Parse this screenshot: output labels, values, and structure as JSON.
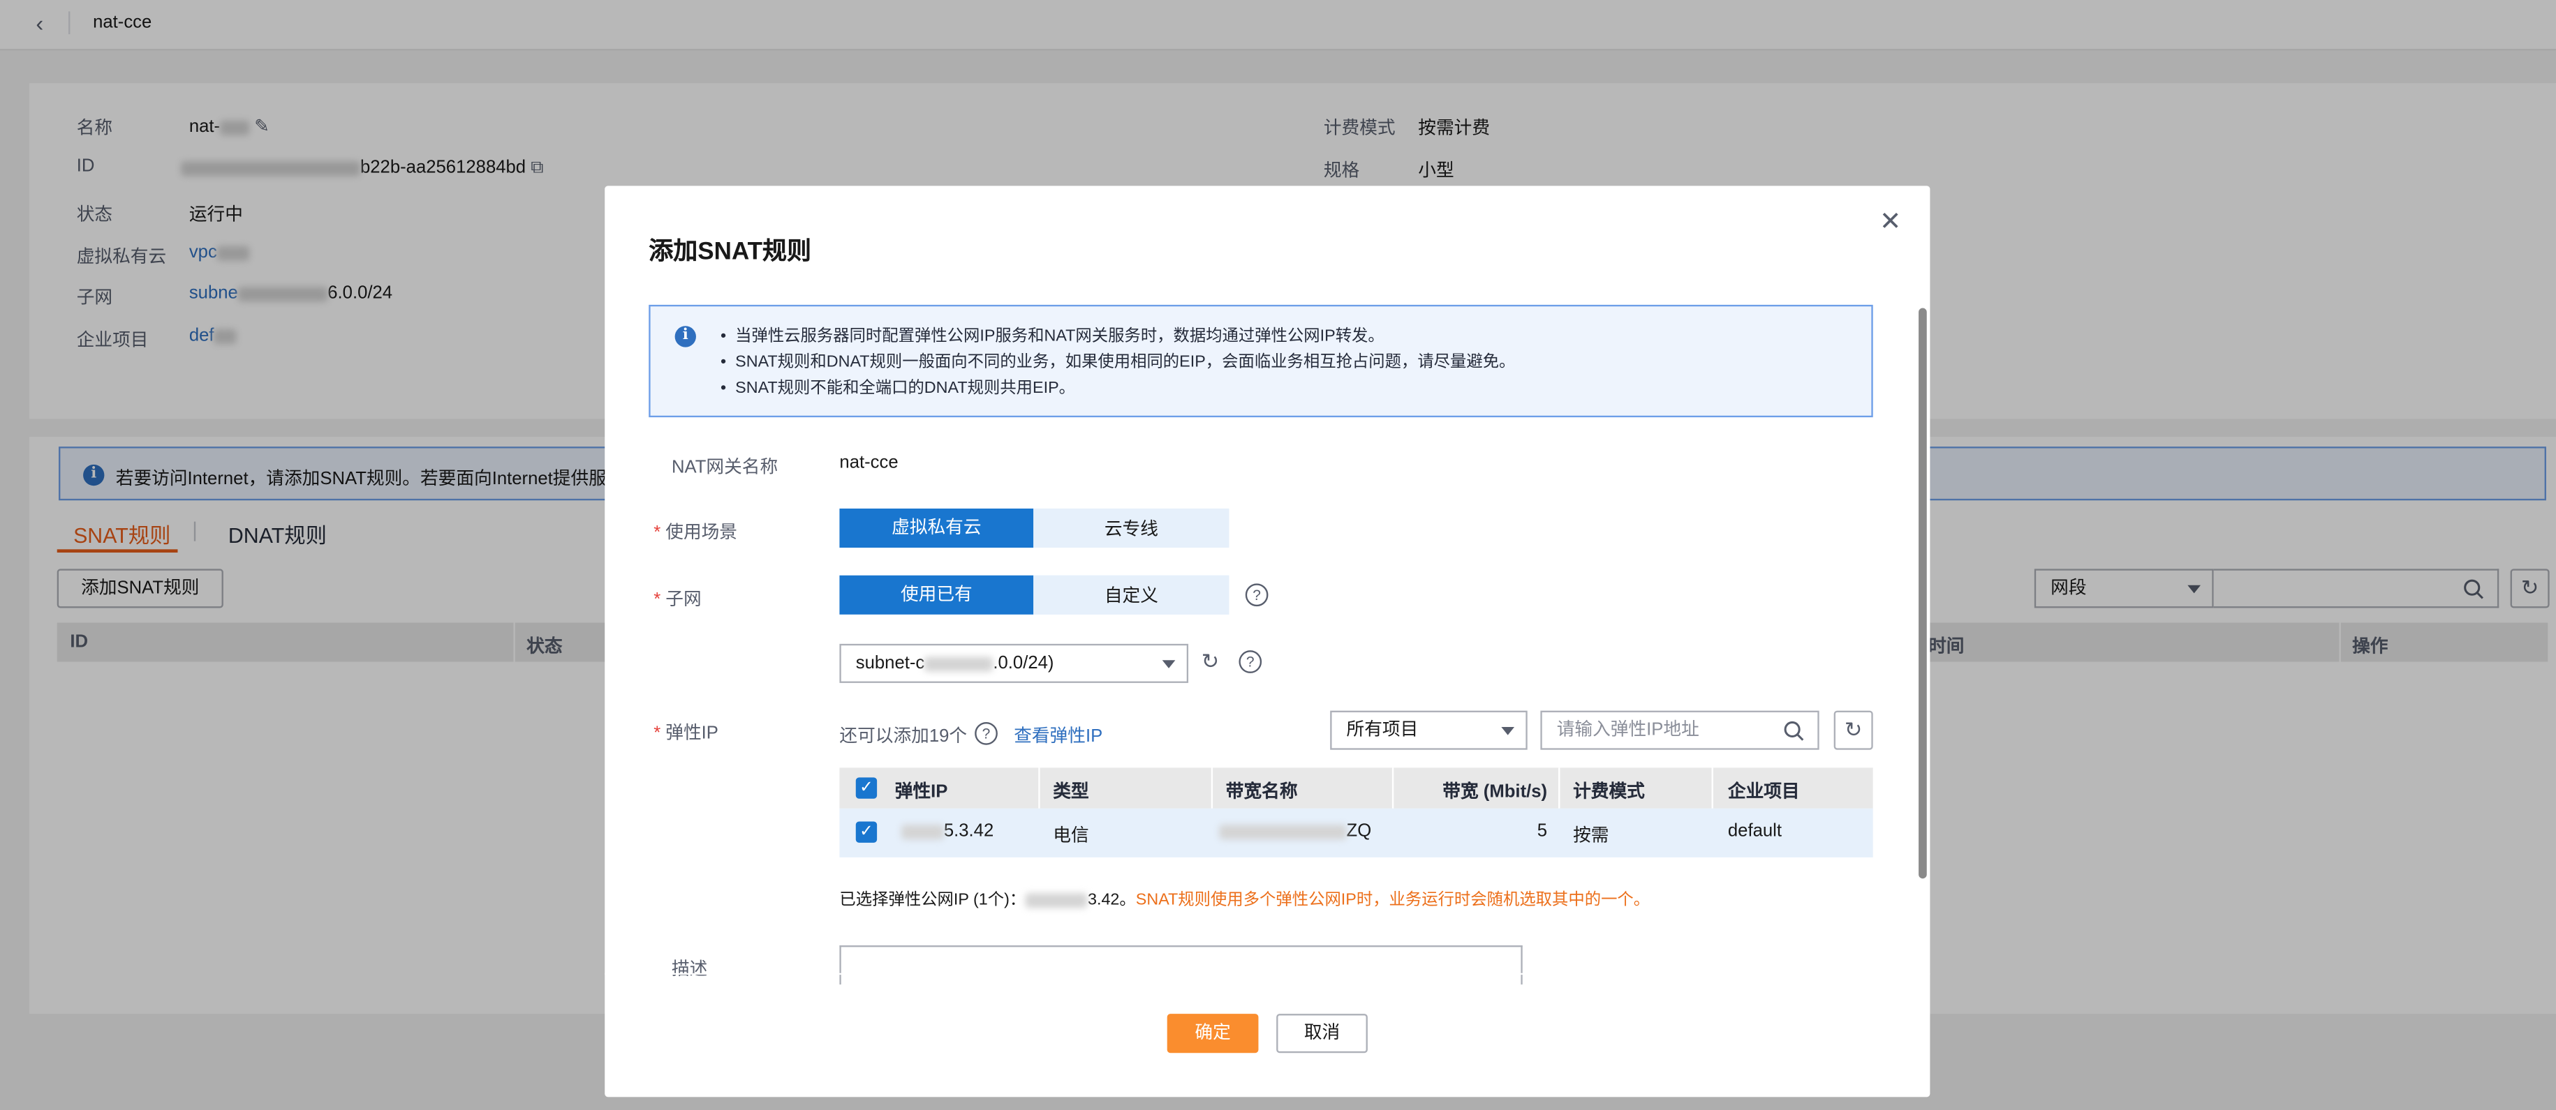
{
  "page": {
    "title": "nat-cce",
    "back_icon": "chevron-left-icon"
  },
  "details": {
    "name_label": "名称",
    "name_value": "nat-",
    "id_label": "ID",
    "id_value": "b22b-aa25612884bd",
    "status_label": "状态",
    "status_value": "运行中",
    "vpc_label": "虚拟私有云",
    "vpc_value": "vpc",
    "subnet_label": "子网",
    "subnet_value_prefix": "subne",
    "subnet_value_suffix": "6.0.0/24",
    "enterprise_label": "企业项目",
    "enterprise_value": "def",
    "billing_label": "计费模式",
    "billing_value": "按需计费",
    "spec_label": "规格",
    "spec_value": "小型"
  },
  "rules": {
    "notice": "若要访问Internet，请添加SNAT规则。若要面向Internet提供服务，",
    "tabs": [
      {
        "label": "SNAT规则",
        "active": true
      },
      {
        "label": "DNAT规则",
        "active": false
      }
    ],
    "add_button": "添加SNAT规则",
    "filter_select": "网段",
    "columns": [
      "ID",
      "状态",
      "时间",
      "操作"
    ]
  },
  "modal": {
    "title": "添加SNAT规则",
    "info": [
      "当弹性云服务器同时配置弹性公网IP服务和NAT网关服务时，数据均通过弹性公网IP转发。",
      "SNAT规则和DNAT规则一般面向不同的业务，如果使用相同的EIP，会面临业务相互抢占问题，请尽量避免。",
      "SNAT规则不能和全端口的DNAT规则共用EIP。"
    ],
    "gateway_label": "NAT网关名称",
    "gateway_value": "nat-cce",
    "scenario_label": "使用场景",
    "scenario_options": [
      "虚拟私有云",
      "云专线"
    ],
    "subnet_label": "子网",
    "subnet_options": [
      "使用已有",
      "自定义"
    ],
    "subnet_select_prefix": "subnet-c",
    "subnet_select_suffix": ".0.0/24)",
    "eip_label": "弹性IP",
    "eip_remaining": "还可以添加19个",
    "eip_view_link": "查看弹性IP",
    "project_select": "所有项目",
    "eip_search_placeholder": "请输入弹性IP地址",
    "table_columns": [
      "弹性IP",
      "类型",
      "带宽名称",
      "带宽 (Mbit/s)",
      "计费模式",
      "企业项目"
    ],
    "table_rows": [
      {
        "eip": "5.3.42",
        "type": "电信",
        "bw_name": "ZQ",
        "bandwidth": "5",
        "billing": "按需",
        "project": "default"
      }
    ],
    "selected_prefix": "已选择弹性公网IP (1个)：",
    "selected_ip": "3.42。",
    "selected_warning": "SNAT规则使用多个弹性公网IP时，业务运行时会随机选取其中的一个。",
    "desc_label": "描述",
    "ok_button": "确定",
    "cancel_button": "取消"
  },
  "colors": {
    "accent": "#1976cf",
    "primary_button": "#fa8d2e",
    "tab_active": "#e85d1a",
    "warning_text": "#ec6f1a"
  }
}
